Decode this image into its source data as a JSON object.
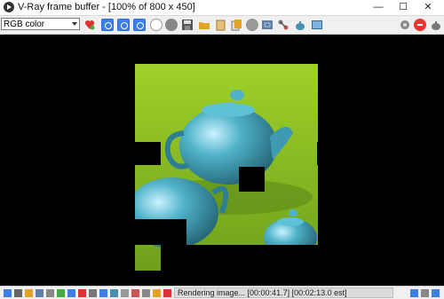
{
  "window": {
    "title": "V-Ray frame buffer - [100% of 800 x 450]"
  },
  "controls": {
    "minimize": "—",
    "maximize": "☐",
    "close": "✕"
  },
  "toolbar": {
    "channel": "RGB color"
  },
  "status": {
    "text": "Rendering image... [00:00:41.7] [00:02:13.0 est]"
  },
  "colors": {
    "accent": "#3c7fe8",
    "render_bg": "#9bc62b",
    "teapot": "#4aa4b8"
  }
}
